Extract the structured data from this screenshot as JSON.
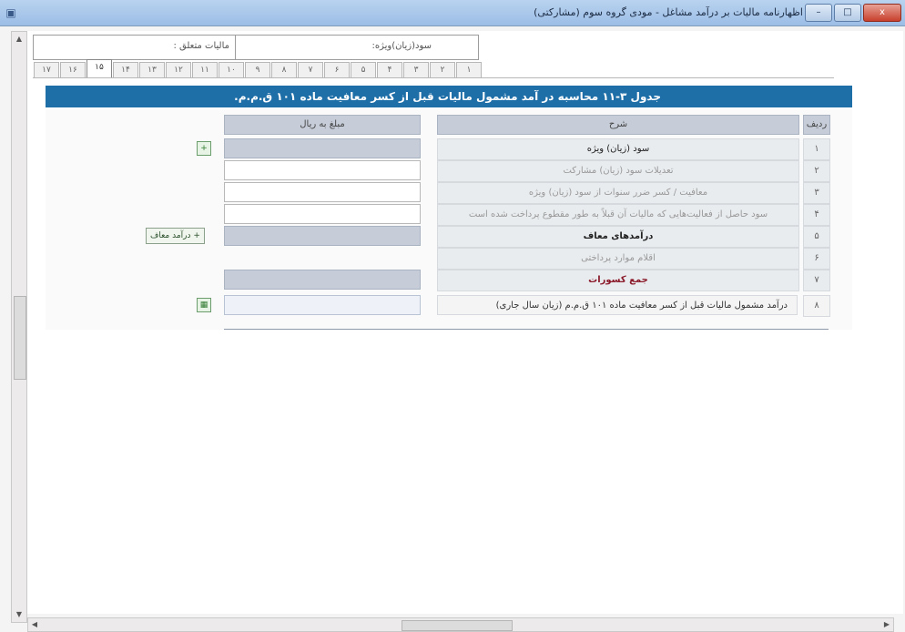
{
  "window": {
    "title": "اظهارنامه مالیات بر درآمد مشاغل - مودی گروه سوم (مشارکتی)",
    "app_icon": "app-form-icon",
    "controls": {
      "minimize": "–",
      "maximize": "□",
      "close": "x"
    }
  },
  "top_fields": {
    "left_label": "مالیات متعلق :",
    "right_label": "سود(زیان)ویژه:"
  },
  "tabs": [
    "۱",
    "۲",
    "۳",
    "۴",
    "۵",
    "۶",
    "۷",
    "۸",
    "۹",
    "۱۰",
    "۱۱",
    "۱۲",
    "۱۳",
    "۱۴",
    "۱۵",
    "۱۶",
    "۱۷"
  ],
  "active_tab": "۱۵",
  "table": {
    "title": "جدول ۳-۱۱ محاسبه در آمد مشمول مالیات قبل از کسر معافیت ماده ۱۰۱ ق.م.م.",
    "columns": {
      "radif": "ردیف",
      "sharh": "شرح",
      "mablagh": "مبلغ به ریال"
    },
    "rows": [
      {
        "radif": "۱",
        "sharh": "سود (زیان) ویژه"
      },
      {
        "radif": "۲",
        "sharh": "تعدیلات سود (زیان) مشارکت"
      },
      {
        "radif": "۳",
        "sharh": "معافیت / کسر ضرر سنوات از سود (زیان) ویژه"
      },
      {
        "radif": "۴",
        "sharh": "سود حاصل از فعالیت‌هایی که مالیات آن قبلاً به طور مقطوع پرداخت شده است"
      },
      {
        "radif": "۵",
        "sharh": "درآمدهای معاف"
      },
      {
        "radif": "۶",
        "sharh": "اقلام موارد پرداختی"
      },
      {
        "radif": "۷",
        "sharh": "جمع کسورات"
      },
      {
        "radif": "۸",
        "sharh": "درآمد مشمول مالیات قبل از کسر معافیت ماده ۱۰۱ ق.م.م (زیان سال جاری)"
      }
    ],
    "row5_button": "درآمد معاف"
  },
  "icons": {
    "add_row1": "plus-icon",
    "add_row5": "plus-icon",
    "add_row8": "calc-icon"
  }
}
